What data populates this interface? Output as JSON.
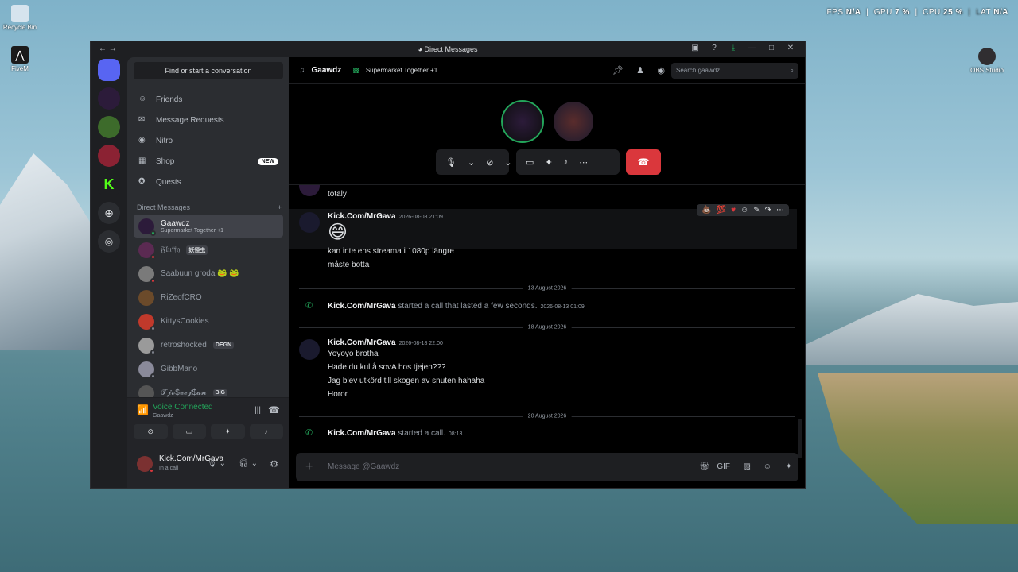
{
  "desktop": {
    "icons": [
      {
        "label": "Recycle Bin"
      },
      {
        "label": "FiveM"
      },
      {
        "label": "OBS Studio"
      }
    ]
  },
  "hud": {
    "fps_label": "FPS",
    "fps": "N/A",
    "gpu_label": "GPU",
    "gpu": "7 %",
    "cpu_label": "CPU",
    "cpu": "25 %",
    "lat_label": "LAT",
    "lat": "N/A"
  },
  "window": {
    "title": "Direct Messages"
  },
  "sidebar": {
    "find": "Find or start a conversation",
    "nav": [
      {
        "label": "Friends"
      },
      {
        "label": "Message Requests"
      },
      {
        "label": "Nitro"
      },
      {
        "label": "Shop",
        "badge": "NEW"
      },
      {
        "label": "Quests"
      }
    ],
    "dm_header": "Direct Messages",
    "dm_add": "+",
    "dms": [
      {
        "name": "Gaawdz",
        "sub": "Supermarket Together +1"
      },
      {
        "name": "𝔉𝔩𝔲𝔣𝔣𝔶",
        "tag": "妖怪虫"
      },
      {
        "name": "Saabuun groda 🐸 🐸"
      },
      {
        "name": "RiZeofCRO"
      },
      {
        "name": "KittysCookies"
      },
      {
        "name": "retroshocked",
        "tag": "DEGN"
      },
      {
        "name": "GibbMano"
      },
      {
        "name": "𝓣𝓳𝓸$𝓿𝓮𝓳$𝓪𝓷",
        "tag": "BIG"
      }
    ],
    "voice": {
      "status": "Voice Connected",
      "channel": "Gaawdz"
    },
    "user": {
      "name": "Kick.Com/MrGava",
      "status": "In a call"
    }
  },
  "header": {
    "name": "Gaawdz",
    "activity": "Supermarket Together +1",
    "search_placeholder": "Search gaawdz"
  },
  "messages": {
    "m0": "totaly",
    "m1": {
      "author": "Kick.Com/MrGava",
      "time": "2026-08-08 21:09",
      "lines": [
        "😄",
        "kan inte ens streama i 1080p längre",
        "måste botta"
      ]
    },
    "d1": "13 August 2026",
    "s1": {
      "author": "Kick.Com/MrGava",
      "text": " started a call that lasted a few seconds.",
      "time": "2026-08-13 01:09"
    },
    "d2": "18 August 2026",
    "m2": {
      "author": "Kick.Com/MrGava",
      "time": "2026-08-18 22:00",
      "lines": [
        "Yoyoyo brotha",
        "Hade du kul å sovA hos tjejen???",
        "Jag blev utkörd till skogen av snuten hahaha",
        "Horor"
      ]
    },
    "d3": "20 August 2026",
    "s2": {
      "author": "Kick.Com/MrGava",
      "text": " started a call.",
      "time": "08:13"
    }
  },
  "composer": {
    "placeholder": "Message @Gaawdz"
  },
  "colors": {
    "accent": "#5865f2",
    "online": "#23a55a",
    "danger": "#da373c"
  }
}
